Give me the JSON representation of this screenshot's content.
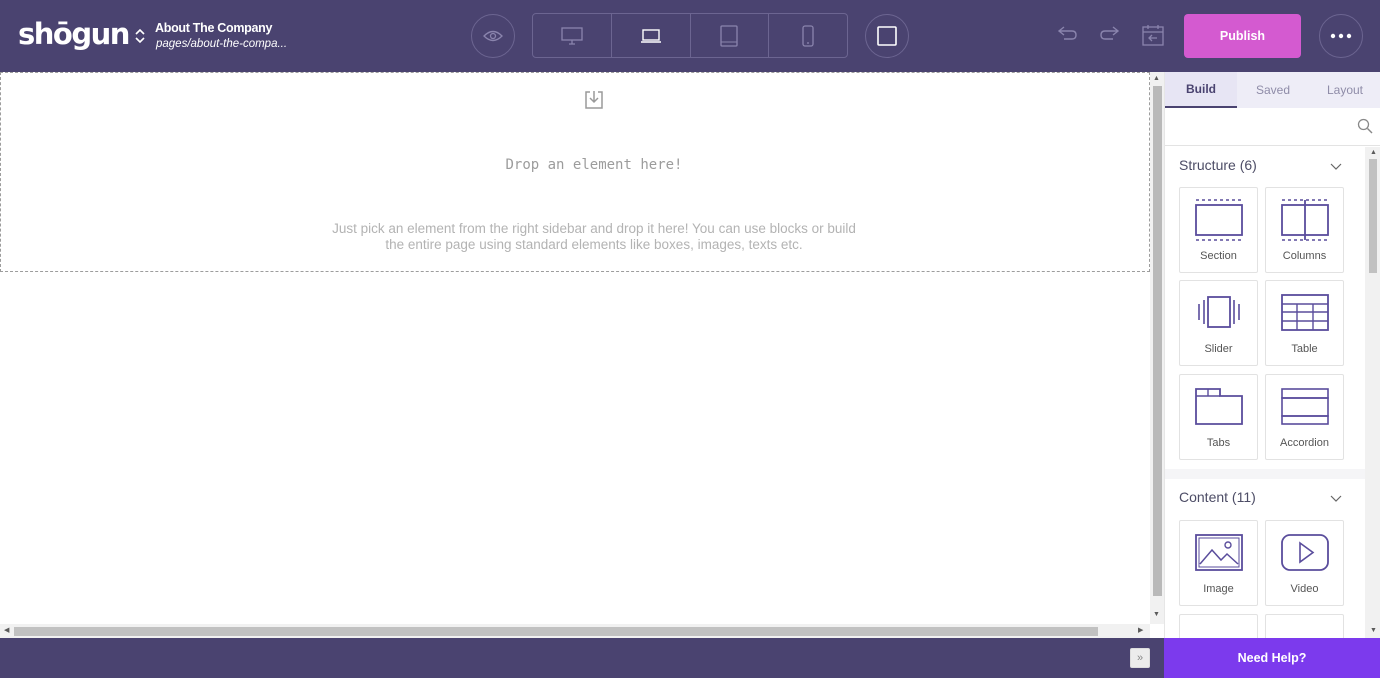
{
  "app": {
    "logo_text": "shōgun"
  },
  "page": {
    "title": "About The Company",
    "path": "pages/about-the-compa..."
  },
  "toolbar": {
    "preview_icon": "eye-icon",
    "devices": [
      "desktop-icon",
      "laptop-icon",
      "tablet-icon",
      "mobile-icon"
    ],
    "active_device": "laptop",
    "publish_label": "Publish",
    "publish_color": "#d45ad0"
  },
  "canvas": {
    "drop_title": "Drop an element here!",
    "drop_description": "Just pick an element from the right sidebar and drop it here! You can use blocks or build the entire page using standard elements like boxes, images, texts etc."
  },
  "sidebar": {
    "tabs": [
      {
        "label": "Build",
        "active": true
      },
      {
        "label": "Saved",
        "active": false
      },
      {
        "label": "Layout",
        "active": false
      }
    ],
    "search_placeholder": "",
    "sections": [
      {
        "title": "Structure (6)",
        "items": [
          {
            "label": "Section",
            "icon": "section-icon"
          },
          {
            "label": "Columns",
            "icon": "columns-icon"
          },
          {
            "label": "Slider",
            "icon": "slider-icon"
          },
          {
            "label": "Table",
            "icon": "table-icon"
          },
          {
            "label": "Tabs",
            "icon": "tabs-icon"
          },
          {
            "label": "Accordion",
            "icon": "accordion-icon"
          }
        ]
      },
      {
        "title": "Content (11)",
        "items": [
          {
            "label": "Image",
            "icon": "image-icon"
          },
          {
            "label": "Video",
            "icon": "video-icon"
          },
          {
            "label": "",
            "icon": "heading-icon"
          },
          {
            "label": "",
            "icon": "text-icon"
          }
        ]
      }
    ]
  },
  "footer": {
    "help_label": "Need Help?",
    "help_color": "#7c3aed"
  },
  "colors": {
    "header_bg": "#4a4370",
    "accent": "#4a4370"
  }
}
